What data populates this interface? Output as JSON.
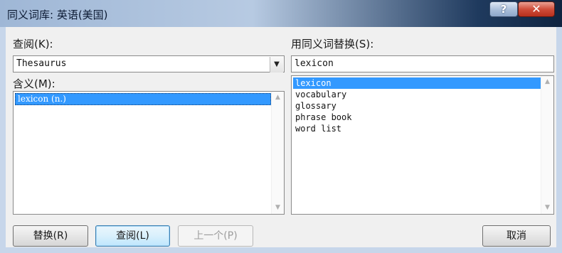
{
  "window": {
    "title": "同义词库: 英语(美国)",
    "help_label": "?",
    "close_label": "✕"
  },
  "lookup": {
    "label": "查阅(K):",
    "value": "Thesaurus",
    "arrow": "▼"
  },
  "meanings": {
    "label": "含义(M):",
    "items": [
      "lexicon (n.)"
    ],
    "selected_index": 0
  },
  "replace": {
    "label": "用同义词替换(S):",
    "value": "lexicon",
    "items": [
      "lexicon",
      "vocabulary",
      "glossary",
      "phrase book",
      "word list"
    ],
    "selected_index": 0
  },
  "scroll": {
    "up_arrow": "▲",
    "down_arrow": "▼"
  },
  "buttons": {
    "replace": "替换(R)",
    "lookup": "查阅(L)",
    "previous": "上一个(P)",
    "cancel": "取消"
  }
}
